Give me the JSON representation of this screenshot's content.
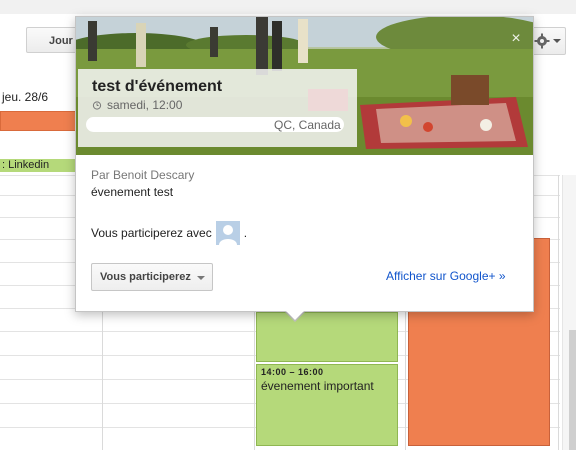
{
  "toolbar": {
    "today_label": "Jour",
    "settings_icon": "gear-icon"
  },
  "calendar": {
    "day_header": "jeu. 28/6",
    "allday_event_label": ": Linkedin",
    "events": [
      {
        "time": "14:00 – 16:00",
        "title": "évenement important"
      }
    ]
  },
  "popup": {
    "title": "test d'événement",
    "date": "samedi, 12:00",
    "location_visible": "QC, Canada",
    "organizer": "Par Benoit Descary",
    "description": "évenement test",
    "attending_prefix": "Vous participerez avec",
    "attending_suffix": ".",
    "rsvp_button": "Vous participerez",
    "gplus_link": "Afficher sur Google+ »",
    "close_glyph": "×"
  },
  "colors": {
    "event_green": "#b5d97a",
    "event_orange": "#ef7f4f",
    "link_blue": "#1155cc"
  }
}
